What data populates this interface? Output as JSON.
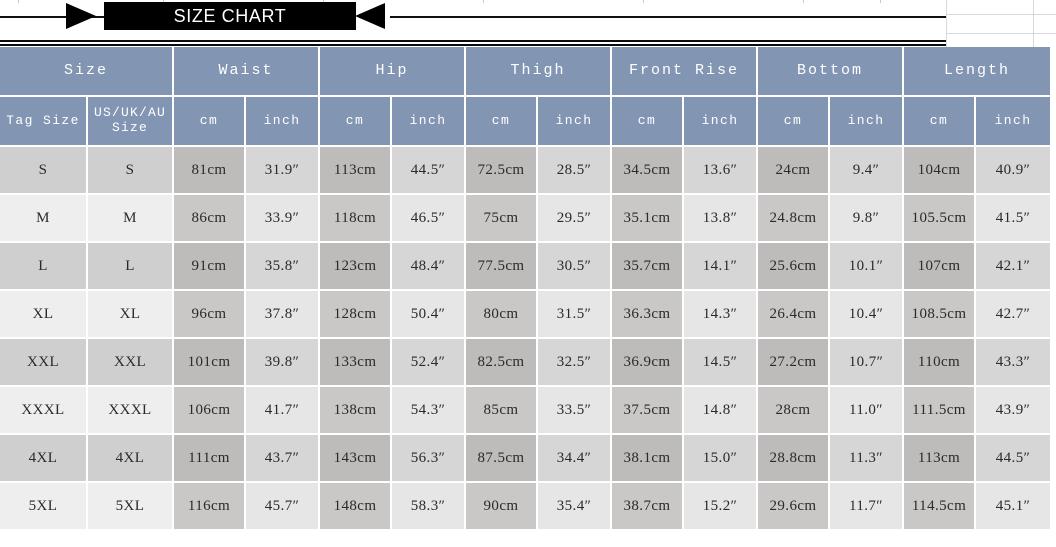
{
  "banner": {
    "title": "SIZE CHART"
  },
  "table": {
    "group_headers": [
      {
        "label": "Size"
      },
      {
        "label": "Waist"
      },
      {
        "label": "Hip"
      },
      {
        "label": "Thigh"
      },
      {
        "label": "Front  Rise"
      },
      {
        "label": "Bottom"
      },
      {
        "label": "Length"
      }
    ],
    "sub_headers": [
      "Tag  Size",
      "US/UK/AU",
      "Size",
      "cm",
      "inch",
      "cm",
      "inch",
      "cm",
      "inch",
      "cm",
      "inch",
      "cm",
      "inch",
      "cm",
      "inch"
    ],
    "rows": [
      {
        "tag": "S",
        "us": "S",
        "waist_cm": "81cm",
        "waist_in": "31.9″",
        "hip_cm": "113cm",
        "hip_in": "44.5″",
        "thigh_cm": "72.5cm",
        "thigh_in": "28.5″",
        "rise_cm": "34.5cm",
        "rise_in": "13.6″",
        "bottom_cm": "24cm",
        "bottom_in": "9.4″",
        "length_cm": "104cm",
        "length_in": "40.9″"
      },
      {
        "tag": "M",
        "us": "M",
        "waist_cm": "86cm",
        "waist_in": "33.9″",
        "hip_cm": "118cm",
        "hip_in": "46.5″",
        "thigh_cm": "75cm",
        "thigh_in": "29.5″",
        "rise_cm": "35.1cm",
        "rise_in": "13.8″",
        "bottom_cm": "24.8cm",
        "bottom_in": "9.8″",
        "length_cm": "105.5cm",
        "length_in": "41.5″"
      },
      {
        "tag": "L",
        "us": "L",
        "waist_cm": "91cm",
        "waist_in": "35.8″",
        "hip_cm": "123cm",
        "hip_in": "48.4″",
        "thigh_cm": "77.5cm",
        "thigh_in": "30.5″",
        "rise_cm": "35.7cm",
        "rise_in": "14.1″",
        "bottom_cm": "25.6cm",
        "bottom_in": "10.1″",
        "length_cm": "107cm",
        "length_in": "42.1″"
      },
      {
        "tag": "XL",
        "us": "XL",
        "waist_cm": "96cm",
        "waist_in": "37.8″",
        "hip_cm": "128cm",
        "hip_in": "50.4″",
        "thigh_cm": "80cm",
        "thigh_in": "31.5″",
        "rise_cm": "36.3cm",
        "rise_in": "14.3″",
        "bottom_cm": "26.4cm",
        "bottom_in": "10.4″",
        "length_cm": "108.5cm",
        "length_in": "42.7″"
      },
      {
        "tag": "XXL",
        "us": "XXL",
        "waist_cm": "101cm",
        "waist_in": "39.8″",
        "hip_cm": "133cm",
        "hip_in": "52.4″",
        "thigh_cm": "82.5cm",
        "thigh_in": "32.5″",
        "rise_cm": "36.9cm",
        "rise_in": "14.5″",
        "bottom_cm": "27.2cm",
        "bottom_in": "10.7″",
        "length_cm": "110cm",
        "length_in": "43.3″"
      },
      {
        "tag": "XXXL",
        "us": "XXXL",
        "waist_cm": "106cm",
        "waist_in": "41.7″",
        "hip_cm": "138cm",
        "hip_in": "54.3″",
        "thigh_cm": "85cm",
        "thigh_in": "33.5″",
        "rise_cm": "37.5cm",
        "rise_in": "14.8″",
        "bottom_cm": "28cm",
        "bottom_in": "11.0″",
        "length_cm": "111.5cm",
        "length_in": "43.9″"
      },
      {
        "tag": "4XL",
        "us": "4XL",
        "waist_cm": "111cm",
        "waist_in": "43.7″",
        "hip_cm": "143cm",
        "hip_in": "56.3″",
        "thigh_cm": "87.5cm",
        "thigh_in": "34.4″",
        "rise_cm": "38.1cm",
        "rise_in": "15.0″",
        "bottom_cm": "28.8cm",
        "bottom_in": "11.3″",
        "length_cm": "113cm",
        "length_in": "44.5″"
      },
      {
        "tag": "5XL",
        "us": "5XL",
        "waist_cm": "116cm",
        "waist_in": "45.7″",
        "hip_cm": "148cm",
        "hip_in": "58.3″",
        "thigh_cm": "90cm",
        "thigh_in": "35.4″",
        "rise_cm": "38.7cm",
        "rise_in": "15.2″",
        "bottom_cm": "29.6cm",
        "bottom_in": "11.7″",
        "length_cm": "114.5cm",
        "length_in": "45.1″"
      }
    ]
  },
  "colors": {
    "header_blue": "#8295b3",
    "banner_black": "#000000",
    "row_light": "#eeeeee",
    "row_dark": "#cfcfcf",
    "cm_dark": "#bdbcbb",
    "cm_light": "#c9c8c7",
    "inch_dark": "#d6d6d6",
    "inch_light": "#e6e6e6"
  }
}
